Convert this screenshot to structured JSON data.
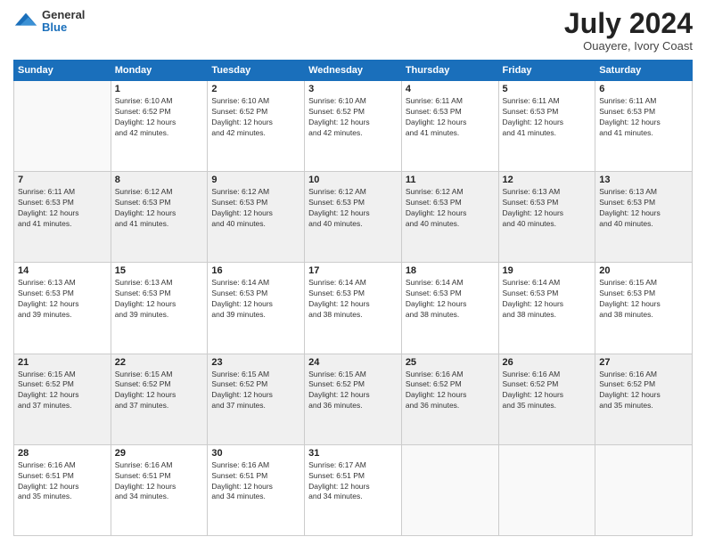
{
  "header": {
    "logo": {
      "general": "General",
      "blue": "Blue"
    },
    "title": "July 2024",
    "location": "Ouayere, Ivory Coast"
  },
  "calendar": {
    "days_of_week": [
      "Sunday",
      "Monday",
      "Tuesday",
      "Wednesday",
      "Thursday",
      "Friday",
      "Saturday"
    ],
    "weeks": [
      {
        "shaded": false,
        "days": [
          {
            "num": "",
            "info": ""
          },
          {
            "num": "1",
            "info": "Sunrise: 6:10 AM\nSunset: 6:52 PM\nDaylight: 12 hours\nand 42 minutes."
          },
          {
            "num": "2",
            "info": "Sunrise: 6:10 AM\nSunset: 6:52 PM\nDaylight: 12 hours\nand 42 minutes."
          },
          {
            "num": "3",
            "info": "Sunrise: 6:10 AM\nSunset: 6:52 PM\nDaylight: 12 hours\nand 42 minutes."
          },
          {
            "num": "4",
            "info": "Sunrise: 6:11 AM\nSunset: 6:53 PM\nDaylight: 12 hours\nand 41 minutes."
          },
          {
            "num": "5",
            "info": "Sunrise: 6:11 AM\nSunset: 6:53 PM\nDaylight: 12 hours\nand 41 minutes."
          },
          {
            "num": "6",
            "info": "Sunrise: 6:11 AM\nSunset: 6:53 PM\nDaylight: 12 hours\nand 41 minutes."
          }
        ]
      },
      {
        "shaded": true,
        "days": [
          {
            "num": "7",
            "info": "Sunrise: 6:11 AM\nSunset: 6:53 PM\nDaylight: 12 hours\nand 41 minutes."
          },
          {
            "num": "8",
            "info": "Sunrise: 6:12 AM\nSunset: 6:53 PM\nDaylight: 12 hours\nand 41 minutes."
          },
          {
            "num": "9",
            "info": "Sunrise: 6:12 AM\nSunset: 6:53 PM\nDaylight: 12 hours\nand 40 minutes."
          },
          {
            "num": "10",
            "info": "Sunrise: 6:12 AM\nSunset: 6:53 PM\nDaylight: 12 hours\nand 40 minutes."
          },
          {
            "num": "11",
            "info": "Sunrise: 6:12 AM\nSunset: 6:53 PM\nDaylight: 12 hours\nand 40 minutes."
          },
          {
            "num": "12",
            "info": "Sunrise: 6:13 AM\nSunset: 6:53 PM\nDaylight: 12 hours\nand 40 minutes."
          },
          {
            "num": "13",
            "info": "Sunrise: 6:13 AM\nSunset: 6:53 PM\nDaylight: 12 hours\nand 40 minutes."
          }
        ]
      },
      {
        "shaded": false,
        "days": [
          {
            "num": "14",
            "info": "Sunrise: 6:13 AM\nSunset: 6:53 PM\nDaylight: 12 hours\nand 39 minutes."
          },
          {
            "num": "15",
            "info": "Sunrise: 6:13 AM\nSunset: 6:53 PM\nDaylight: 12 hours\nand 39 minutes."
          },
          {
            "num": "16",
            "info": "Sunrise: 6:14 AM\nSunset: 6:53 PM\nDaylight: 12 hours\nand 39 minutes."
          },
          {
            "num": "17",
            "info": "Sunrise: 6:14 AM\nSunset: 6:53 PM\nDaylight: 12 hours\nand 38 minutes."
          },
          {
            "num": "18",
            "info": "Sunrise: 6:14 AM\nSunset: 6:53 PM\nDaylight: 12 hours\nand 38 minutes."
          },
          {
            "num": "19",
            "info": "Sunrise: 6:14 AM\nSunset: 6:53 PM\nDaylight: 12 hours\nand 38 minutes."
          },
          {
            "num": "20",
            "info": "Sunrise: 6:15 AM\nSunset: 6:53 PM\nDaylight: 12 hours\nand 38 minutes."
          }
        ]
      },
      {
        "shaded": true,
        "days": [
          {
            "num": "21",
            "info": "Sunrise: 6:15 AM\nSunset: 6:52 PM\nDaylight: 12 hours\nand 37 minutes."
          },
          {
            "num": "22",
            "info": "Sunrise: 6:15 AM\nSunset: 6:52 PM\nDaylight: 12 hours\nand 37 minutes."
          },
          {
            "num": "23",
            "info": "Sunrise: 6:15 AM\nSunset: 6:52 PM\nDaylight: 12 hours\nand 37 minutes."
          },
          {
            "num": "24",
            "info": "Sunrise: 6:15 AM\nSunset: 6:52 PM\nDaylight: 12 hours\nand 36 minutes."
          },
          {
            "num": "25",
            "info": "Sunrise: 6:16 AM\nSunset: 6:52 PM\nDaylight: 12 hours\nand 36 minutes."
          },
          {
            "num": "26",
            "info": "Sunrise: 6:16 AM\nSunset: 6:52 PM\nDaylight: 12 hours\nand 35 minutes."
          },
          {
            "num": "27",
            "info": "Sunrise: 6:16 AM\nSunset: 6:52 PM\nDaylight: 12 hours\nand 35 minutes."
          }
        ]
      },
      {
        "shaded": false,
        "days": [
          {
            "num": "28",
            "info": "Sunrise: 6:16 AM\nSunset: 6:51 PM\nDaylight: 12 hours\nand 35 minutes."
          },
          {
            "num": "29",
            "info": "Sunrise: 6:16 AM\nSunset: 6:51 PM\nDaylight: 12 hours\nand 34 minutes."
          },
          {
            "num": "30",
            "info": "Sunrise: 6:16 AM\nSunset: 6:51 PM\nDaylight: 12 hours\nand 34 minutes."
          },
          {
            "num": "31",
            "info": "Sunrise: 6:17 AM\nSunset: 6:51 PM\nDaylight: 12 hours\nand 34 minutes."
          },
          {
            "num": "",
            "info": ""
          },
          {
            "num": "",
            "info": ""
          },
          {
            "num": "",
            "info": ""
          }
        ]
      }
    ]
  }
}
